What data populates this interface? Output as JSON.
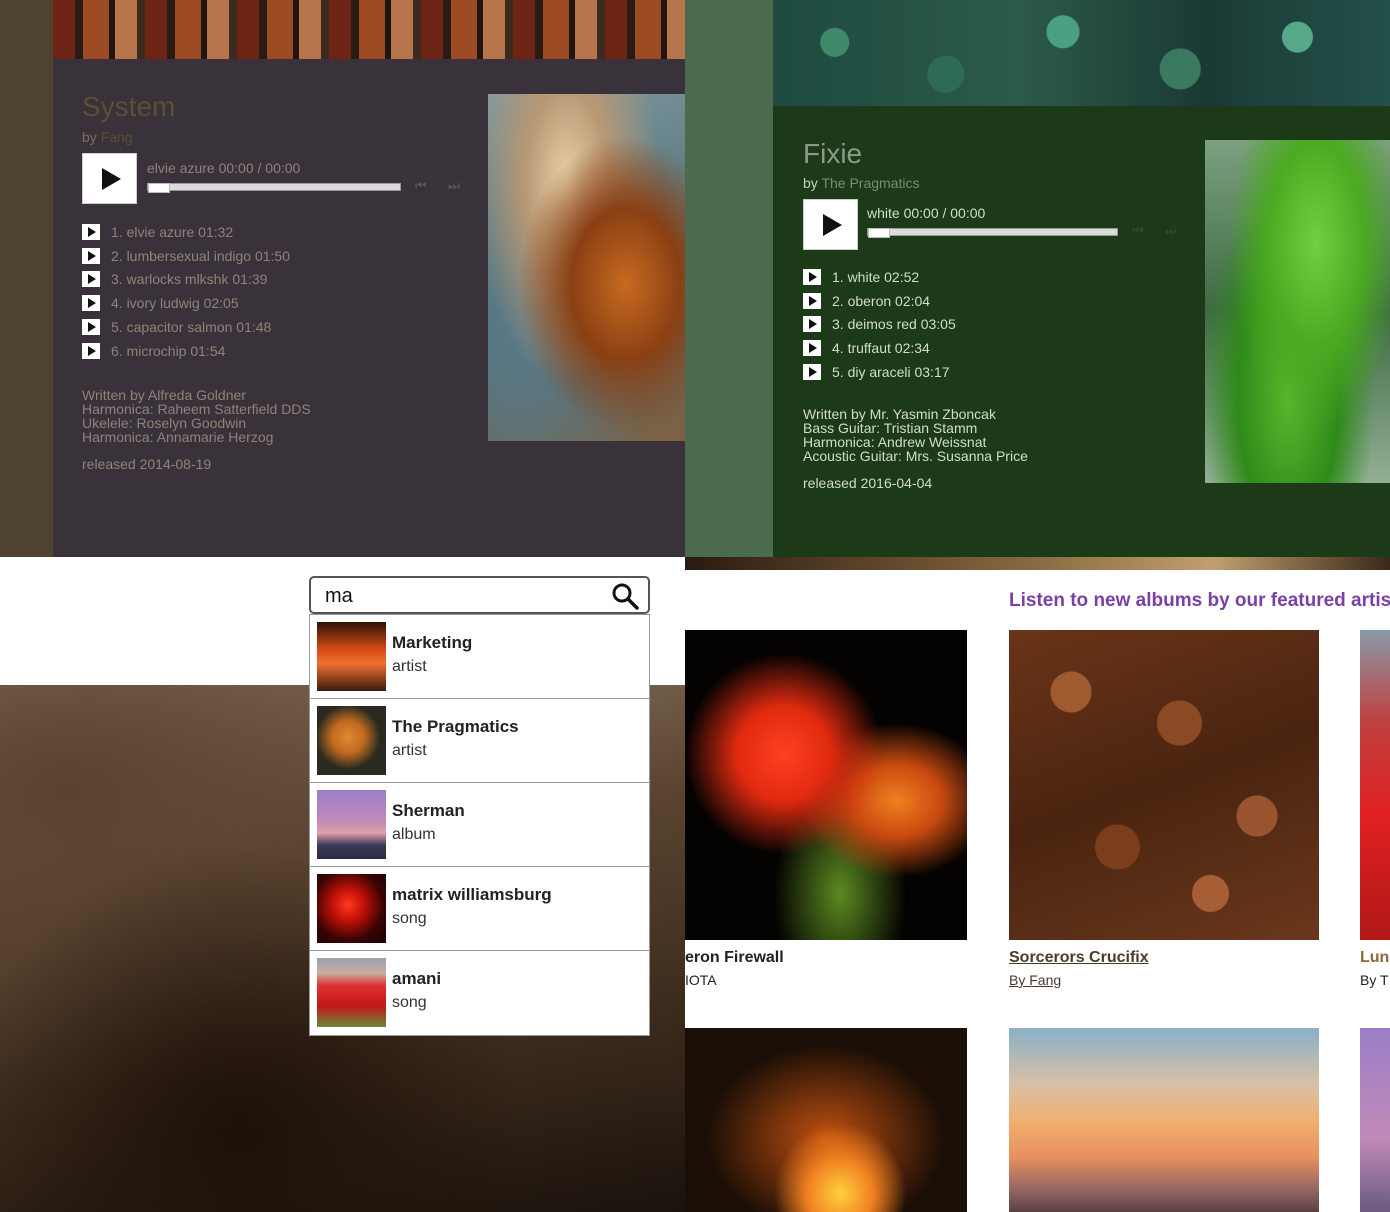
{
  "album_system": {
    "title": "System",
    "by_prefix": "by",
    "artist": "Fang",
    "now_playing": "elvie azure 00:00 / 00:00",
    "tracks": [
      "1. elvie azure 01:32",
      "2. lumbersexual indigo 01:50",
      "3. warlocks mlkshk 01:39",
      "4. ivory ludwig 02:05",
      "5. capacitor salmon 01:48",
      "6. microchip 01:54"
    ],
    "credits": [
      "Written by Alfreda Goldner",
      "Harmonica: Raheem Satterfield DDS",
      "Ukelele: Roselyn Goodwin",
      "Harmonica: Annamarie Herzog"
    ],
    "released": "released 2014-08-19",
    "prev_icon": "⏮",
    "next_icon": "⏭"
  },
  "album_fixie": {
    "title": "Fixie",
    "by_prefix": "by",
    "artist": "The Pragmatics",
    "now_playing": "white 00:00 / 00:00",
    "tracks": [
      "1. white 02:52",
      "2. oberon 02:04",
      "3. deimos red 03:05",
      "4. truffaut 02:34",
      "5. diy araceli 03:17"
    ],
    "credits": [
      "Written by Mr. Yasmin Zboncak",
      "Bass Guitar: Tristian Stamm",
      "Harmonica: Andrew Weissnat",
      "Acoustic Guitar: Mrs. Susanna Price"
    ],
    "released": "released 2016-04-04",
    "prev_icon": "⏮",
    "next_icon": "⏭"
  },
  "search": {
    "value": "ma",
    "results": [
      {
        "name": "Marketing",
        "type": "artist"
      },
      {
        "name": "The Pragmatics",
        "type": "artist"
      },
      {
        "name": "Sherman",
        "type": "album"
      },
      {
        "name": "matrix williamsburg",
        "type": "song"
      },
      {
        "name": "amani",
        "type": "song"
      }
    ]
  },
  "featured": {
    "heading": "Listen to new albums by our featured artist",
    "albums": [
      {
        "title": "eron Firewall",
        "artist": "IOTA"
      },
      {
        "title": "Sorcerors Crucifix",
        "artist": "By Fang"
      },
      {
        "title": "Lun",
        "artist": "By T"
      }
    ]
  },
  "icons": {
    "play": "play-icon",
    "search": "magnifier-icon"
  }
}
